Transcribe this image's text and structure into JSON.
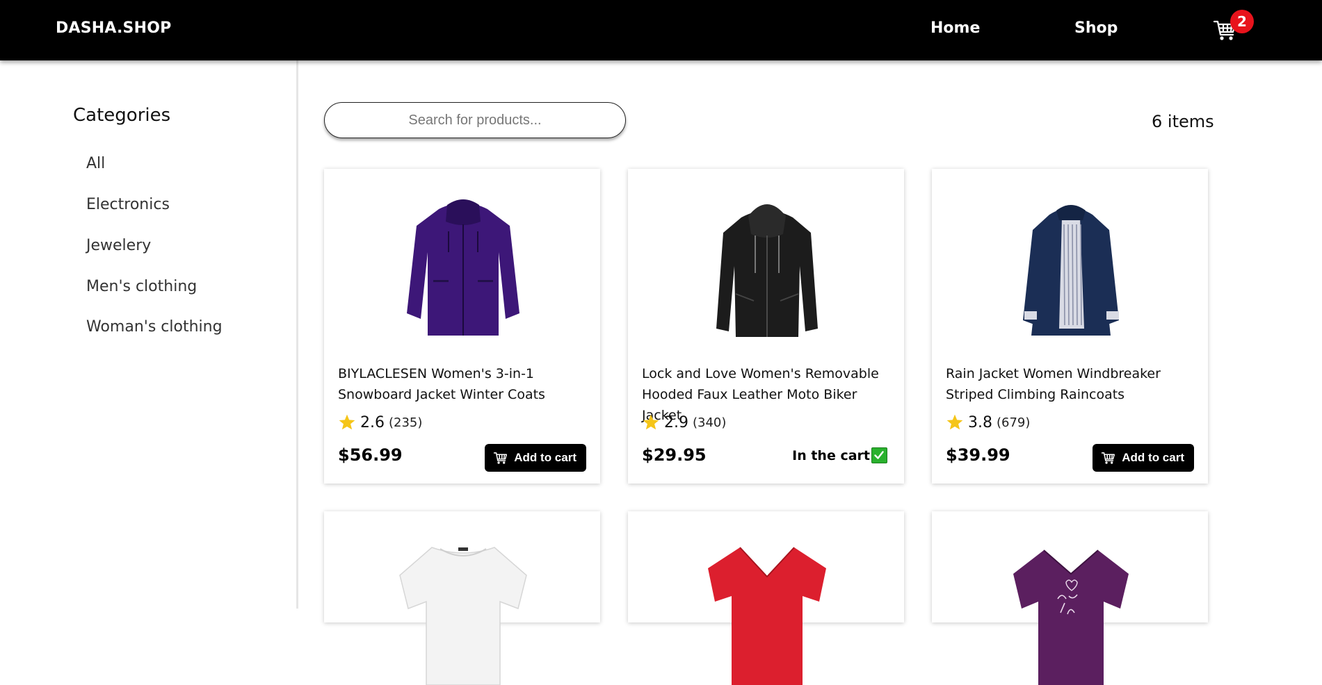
{
  "header": {
    "brand": "DASHA.SHOP",
    "nav": [
      {
        "label": "Home"
      },
      {
        "label": "Shop"
      }
    ],
    "cart_count": "2"
  },
  "sidebar": {
    "title": "Categories",
    "items": [
      {
        "label": "All"
      },
      {
        "label": "Electronics"
      },
      {
        "label": "Jewelery"
      },
      {
        "label": "Men's clothing"
      },
      {
        "label": "Woman's clothing"
      }
    ]
  },
  "search": {
    "placeholder": "Search for products...",
    "value": ""
  },
  "items_count": "6 items",
  "products": [
    {
      "title": "BIYLACLESEN Women's 3-in-1 Snowboard Jacket Winter Coats",
      "rating": "2.6",
      "reviews": "(235)",
      "price": "$56.99",
      "action": "Add to cart",
      "image_icon": "purple-jacket-icon"
    },
    {
      "title": "Lock and Love Women's Removable Hooded Faux Leather Moto Biker Jacket",
      "rating": "2.9",
      "reviews": "(340)",
      "price": "$29.95",
      "action": "In the cart",
      "image_icon": "black-leather-jacket-icon"
    },
    {
      "title": "Rain Jacket Women Windbreaker Striped Climbing Raincoats",
      "rating": "3.8",
      "reviews": "(679)",
      "price": "$39.99",
      "action": "Add to cart",
      "image_icon": "navy-raincoat-icon"
    },
    {
      "image_icon": "white-tshirt-icon"
    },
    {
      "image_icon": "red-tshirt-icon"
    },
    {
      "image_icon": "purple-tshirt-icon"
    }
  ],
  "colors": {
    "header_bg": "#000000",
    "badge": "#e8131c",
    "star": "#f5c518",
    "check": "#29b12d"
  }
}
